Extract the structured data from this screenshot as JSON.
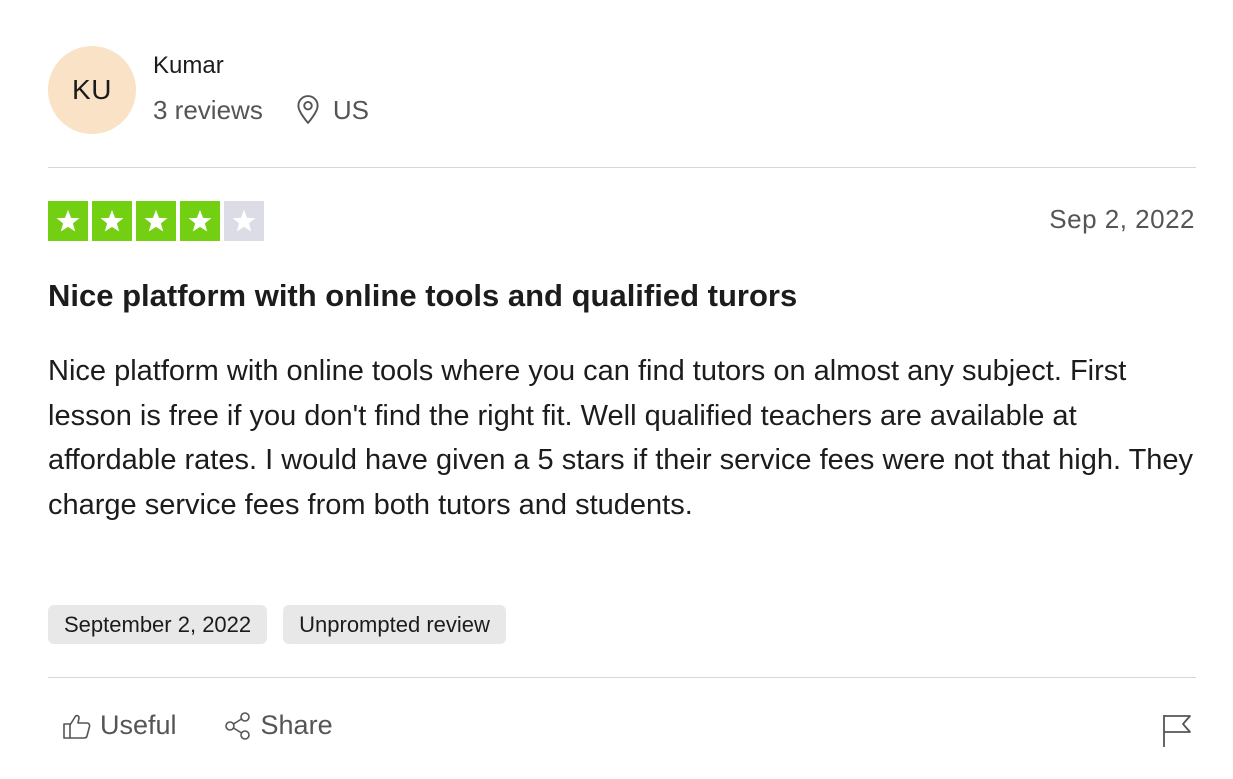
{
  "reviewer": {
    "initials": "KU",
    "name": "Kumar",
    "reviews_count": "3 reviews",
    "location": "US",
    "avatar_color": "#f9e2c5"
  },
  "rating": {
    "value": 4,
    "max": 5,
    "filled_color": "#73cf11",
    "empty_color": "#dcdce6",
    "date": "Sep 2, 2022"
  },
  "review": {
    "title": "Nice platform with online tools and qualified turors",
    "body": "Nice platform with online tools where you can find tutors on almost any subject. First lesson is free if you don't find the right fit. Well qualified teachers are available at affordable rates. I would have given a 5 stars if their service fees were not that high. They charge service fees from both tutors and students."
  },
  "tags": {
    "date_of_experience": "September 2, 2022",
    "review_type": "Unprompted review"
  },
  "actions": {
    "useful_label": "Useful",
    "share_label": "Share",
    "useful_icon": "thumbs-up-icon",
    "share_icon": "share-icon",
    "flag_icon": "flag-icon"
  }
}
